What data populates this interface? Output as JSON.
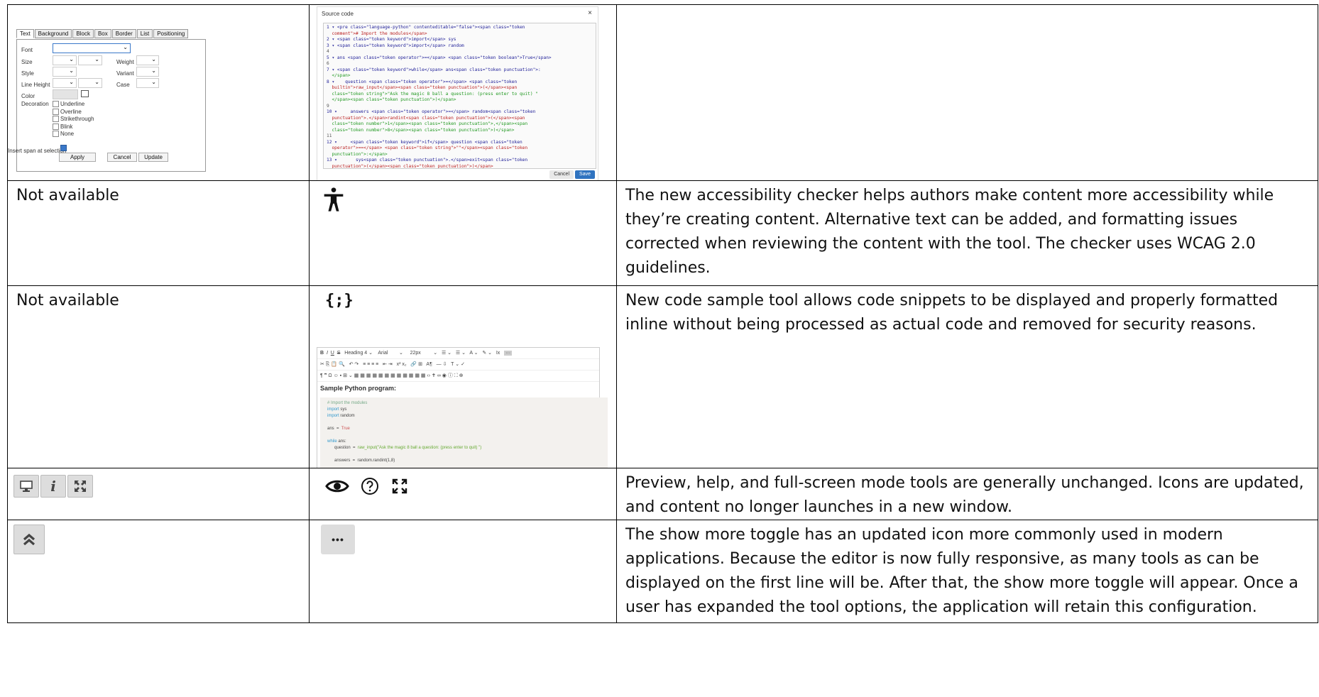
{
  "rows": [
    {
      "old": "",
      "desc": ""
    },
    {
      "old": "Not available",
      "desc": "The new accessibility checker helps authors make content more accessibility while they’re creating content. Alternative text can be added, and formatting issues corrected when reviewing the content with the tool. The checker uses WCAG 2.0 guidelines."
    },
    {
      "old": "Not available",
      "desc": "New code sample tool allows code snippets to be displayed and properly formatted inline without being processed as actual code and removed for security reasons."
    },
    {
      "old": "",
      "desc": "Preview, help, and full-screen mode tools are generally unchanged. Icons are updated, and content no longer launches in a new window."
    },
    {
      "old": "",
      "desc": "The show more toggle has an updated icon more commonly used in modern applications. Because the editor is now fully responsive, as many tools as can be displayed on the first line will be. After that, the show more toggle will appear. Once a user has expanded the tool options, the application will retain this configuration."
    }
  ],
  "style_dialog": {
    "tabs": [
      "Text",
      "Background",
      "Block",
      "Box",
      "Border",
      "List",
      "Positioning"
    ],
    "labels": {
      "font": "Font",
      "size": "Size",
      "weight": "Weight",
      "style": "Style",
      "variant": "Variant",
      "line_height": "Line Height",
      "case": "Case",
      "color": "Color",
      "decoration": "Decoration"
    },
    "decorations": [
      "Underline",
      "Overline",
      "Strikethrough",
      "Blink",
      "None"
    ],
    "insert_label": "Insert span at selection",
    "apply": "Apply",
    "cancel": "Cancel",
    "update": "Update"
  },
  "source_dialog": {
    "title": "Source code",
    "close": "×",
    "cancel": "Cancel",
    "save": "Save"
  },
  "editor_sample": {
    "heading_select": "Heading 4",
    "font_select": "Arial",
    "size_select": "22px",
    "title": "Sample Python program:"
  },
  "icons": {
    "accessibility": "accessibility-icon",
    "code_sample": "code-sample-icon",
    "code_sample_glyph": "{;}",
    "more": "more-horizontal-icon",
    "more_glyph": "•••"
  }
}
